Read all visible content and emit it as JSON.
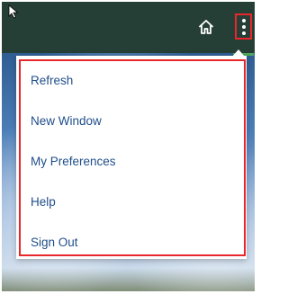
{
  "header": {
    "home_icon": "home-icon",
    "more_icon": "kebab-menu-icon"
  },
  "menu": {
    "items": [
      {
        "label": "Refresh"
      },
      {
        "label": "New Window"
      },
      {
        "label": "My Preferences"
      },
      {
        "label": "Help"
      },
      {
        "label": "Sign Out"
      }
    ]
  },
  "colors": {
    "header_bg": "#263f36",
    "highlight_border": "#e8262b",
    "menu_text": "#1f4e8a",
    "active_indicator": "#4fa65c"
  }
}
